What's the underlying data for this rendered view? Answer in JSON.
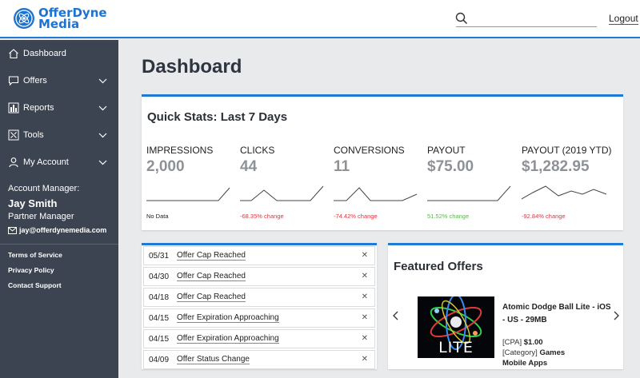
{
  "brand": {
    "line1": "OfferDyne",
    "line2": "Media"
  },
  "header": {
    "logout_label": "Logout"
  },
  "sidebar": {
    "items": [
      {
        "label": "Dashboard"
      },
      {
        "label": "Offers"
      },
      {
        "label": "Reports"
      },
      {
        "label": "Tools"
      },
      {
        "label": "My Account"
      }
    ],
    "account": {
      "label": "Account Manager:",
      "name": "Jay Smith",
      "role": "Partner Manager",
      "email": "jay@offerdynemedia.com"
    },
    "links": [
      "Terms of Service",
      "Privacy Policy",
      "Contact Support"
    ]
  },
  "page": {
    "title": "Dashboard"
  },
  "quick_stats": {
    "title": "Quick Stats: Last 7 Days",
    "stats": [
      {
        "label": "IMPRESSIONS",
        "value": "2,000",
        "change": "No Data",
        "change_color": "#222222"
      },
      {
        "label": "CLICKS",
        "value": "44",
        "change": "-68.35% change",
        "change_color": "#e0343a"
      },
      {
        "label": "CONVERSIONS",
        "value": "11",
        "change": "-74.42% change",
        "change_color": "#e0343a"
      },
      {
        "label": "PAYOUT",
        "value": "$75.00",
        "change": "51.52% change",
        "change_color": "#57b947"
      },
      {
        "label": "PAYOUT (2019 YTD)",
        "value": "$1,282.95",
        "change": "-92.84% change",
        "change_color": "#e0343a"
      }
    ]
  },
  "alerts": [
    {
      "date": "05/31",
      "text": "Offer Cap Reached"
    },
    {
      "date": "04/30",
      "text": "Offer Cap Reached"
    },
    {
      "date": "04/18",
      "text": "Offer Cap Reached"
    },
    {
      "date": "04/15",
      "text": "Offer Expiration Approaching"
    },
    {
      "date": "04/15",
      "text": "Offer Expiration Approaching"
    },
    {
      "date": "04/09",
      "text": "Offer Status Change"
    }
  ],
  "featured": {
    "title": "Featured Offers",
    "offer": {
      "name": "Atomic Dodge Ball Lite - iOS - US - 29MB",
      "image_caption": "LITE",
      "type_tag": "[CPA]",
      "payout": "$1.00",
      "category_tag": "[Category]",
      "category_value": "Games",
      "category_value2": "Mobile Apps"
    }
  },
  "colors": {
    "accent": "#1f7ad6",
    "sidebar": "#3d4451"
  }
}
